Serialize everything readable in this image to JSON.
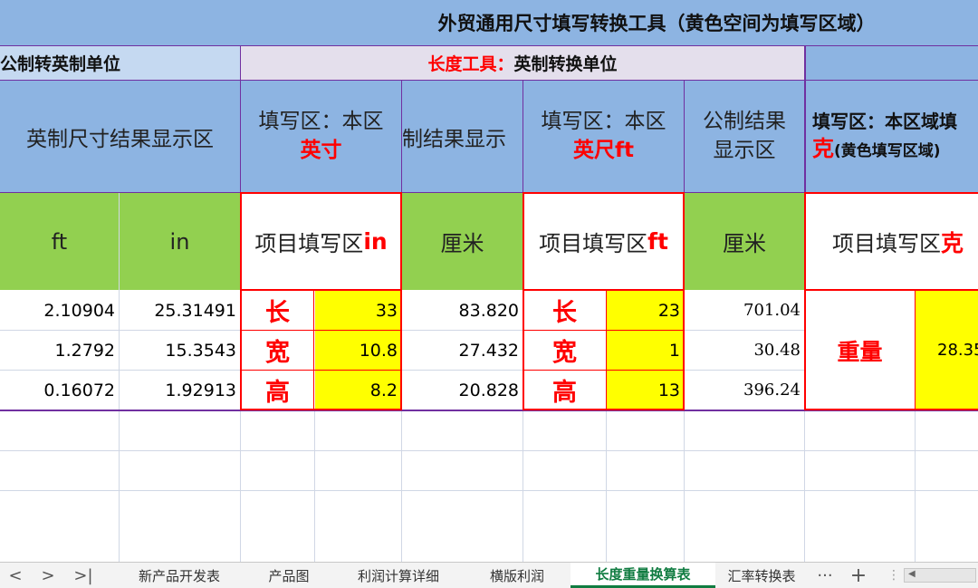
{
  "sheet": {
    "title": "外贸通用尺寸填写转换工具（黄色空间为填写区域）",
    "left_section": "公制转英制单位",
    "length_tool_prefix": "长度工具：",
    "length_tool_suffix": "英制转换单位",
    "imperial_result_area": "英制尺寸结果显示区",
    "fill_area_inch_line1": "填写区：本区",
    "fill_area_inch_line2": "英寸",
    "metric_result_display": "制结果显示",
    "fill_area_ft_line1": "填写区：本区",
    "fill_area_ft_line2": "英尺ft",
    "metric_result_area_line1": "公制结果",
    "metric_result_area_line2": "显示区",
    "fill_area_gram_line1": "填写区：本区域填",
    "fill_area_gram_line2_red": "克",
    "fill_area_gram_line2_rest": "(黄色填写区域)",
    "col_ft": "ft",
    "col_in": "in",
    "item_fill_prefix": "项目填写区",
    "item_fill_in": "in",
    "col_cm1": "厘米",
    "item_fill_ft": "ft",
    "col_cm2": "厘米",
    "item_fill_gram": "克",
    "weight_label": "重量",
    "weight_value": "28.35"
  },
  "rows": [
    {
      "ft": "2.10904",
      "in": "25.31491",
      "label": "长",
      "inch_val": "33",
      "cm1": "83.820",
      "label2": "长",
      "ft_val": "23",
      "cm2": "701.04"
    },
    {
      "ft": "1.2792",
      "in": "15.3543",
      "label": "宽",
      "inch_val": "10.8",
      "cm1": "27.432",
      "label2": "宽",
      "ft_val": "1",
      "cm2": "30.48"
    },
    {
      "ft": "0.16072",
      "in": "1.92913",
      "label": "高",
      "inch_val": "8.2",
      "cm1": "20.828",
      "label2": "高",
      "ft_val": "13",
      "cm2": "396.24"
    }
  ],
  "tabs": {
    "nav_prev": "<",
    "nav_next": ">",
    "nav_last": ">|",
    "items": [
      "新产品开发表",
      "产品图",
      "利润计算详细",
      "横版利润",
      "长度重量换算表",
      "汇率转换表"
    ],
    "more": "···",
    "add": "+"
  },
  "colors": {
    "header_blue": "#8db4e2",
    "green": "#92d050",
    "yellow": "#ffff00",
    "red": "#ff0000",
    "purple": "#7030a0"
  }
}
